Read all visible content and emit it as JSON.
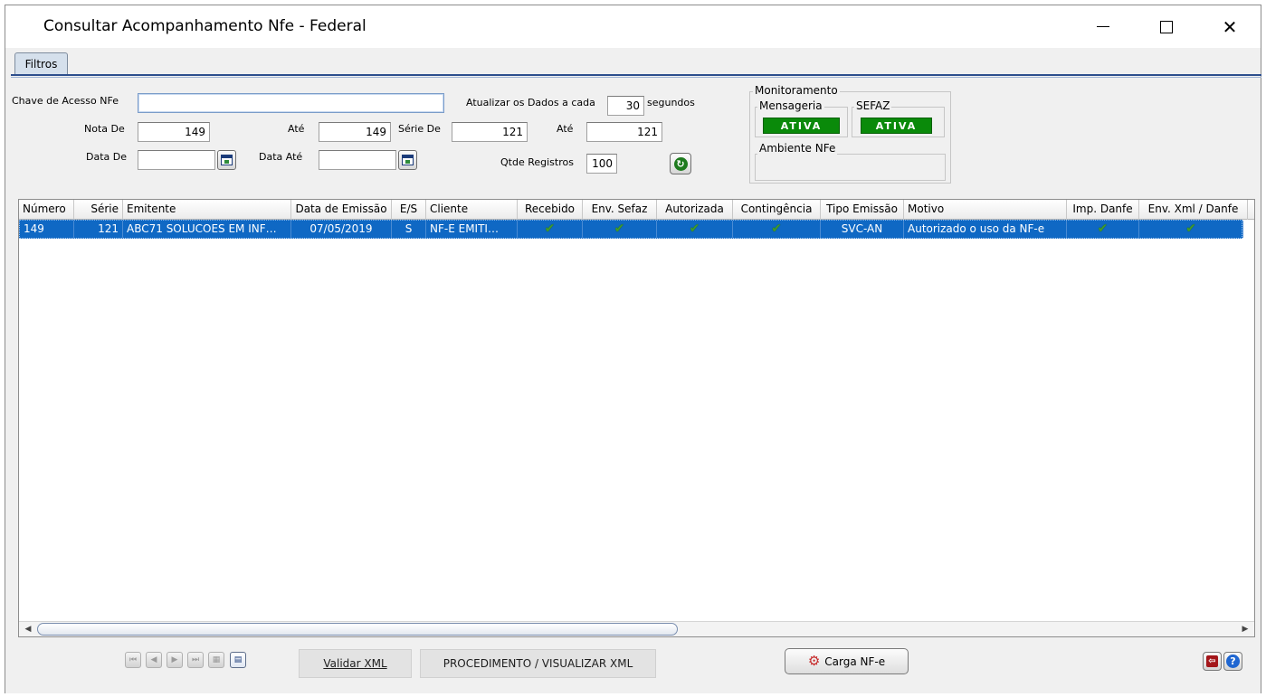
{
  "window": {
    "title": "Consultar Acompanhamento Nfe - Federal",
    "minimize": "—",
    "maximize": "☐",
    "close": "✕"
  },
  "tabs": [
    {
      "label": "Filtros"
    }
  ],
  "filters": {
    "chave_label": "Chave de Acesso NFe",
    "chave_value": "",
    "nota_de_label": "Nota De",
    "nota_de_value": "149",
    "nota_ate_label": "Até",
    "nota_ate_value": "149",
    "serie_de_label": "Série De",
    "serie_de_value": "121",
    "serie_ate_label": "Até",
    "serie_ate_value": "121",
    "data_de_label": "Data De",
    "data_de_value": "",
    "data_ate_label": "Data Até",
    "data_ate_value": "",
    "atualizar_label": "Atualizar os Dados a cada",
    "atualizar_value": "30",
    "segundos_label": "segundos",
    "qtde_label": "Qtde Registros",
    "qtde_value": "100"
  },
  "monitoramento": {
    "title": "Monitoramento",
    "mensageria_label": "Mensageria",
    "mensageria_status": "ATIVA",
    "sefaz_label": "SEFAZ",
    "sefaz_status": "ATIVA",
    "ambiente_label": "Ambiente NFe",
    "ambiente_value": "",
    "status_color": "#0a8a0a"
  },
  "grid": {
    "columns": [
      "Número",
      "Série",
      "Emitente",
      "Data de Emissão",
      "E/S",
      "Cliente",
      "Recebido",
      "Env. Sefaz",
      "Autorizada",
      "Contingência",
      "Tipo Emissão",
      "Motivo",
      "Imp. Danfe",
      "Env. Xml / Danfe"
    ],
    "rows": [
      {
        "numero": "149",
        "serie": "121",
        "emitente": "ABC71 SOLUCOES EM INF…",
        "data_emissao": "07/05/2019",
        "es": "S",
        "cliente": "NF-E EMITI…",
        "recebido": "✔",
        "env_sefaz": "✔",
        "autorizada": "✔",
        "contingencia": "✔",
        "tipo_emissao": "SVC-AN",
        "motivo": "Autorizado o uso da NF-e",
        "imp_danfe": "✔",
        "env_xml_danfe": "✔"
      }
    ],
    "selected_color": "#0f68c4"
  },
  "footer": {
    "nav_first": "⏮",
    "nav_prev": "◀",
    "nav_next": "▶",
    "nav_last": "⏭",
    "validar_xml": "Validar XML",
    "procedimento": "PROCEDIMENTO / VISUALIZAR XML",
    "carga_nfe": "Carga NF-e"
  }
}
